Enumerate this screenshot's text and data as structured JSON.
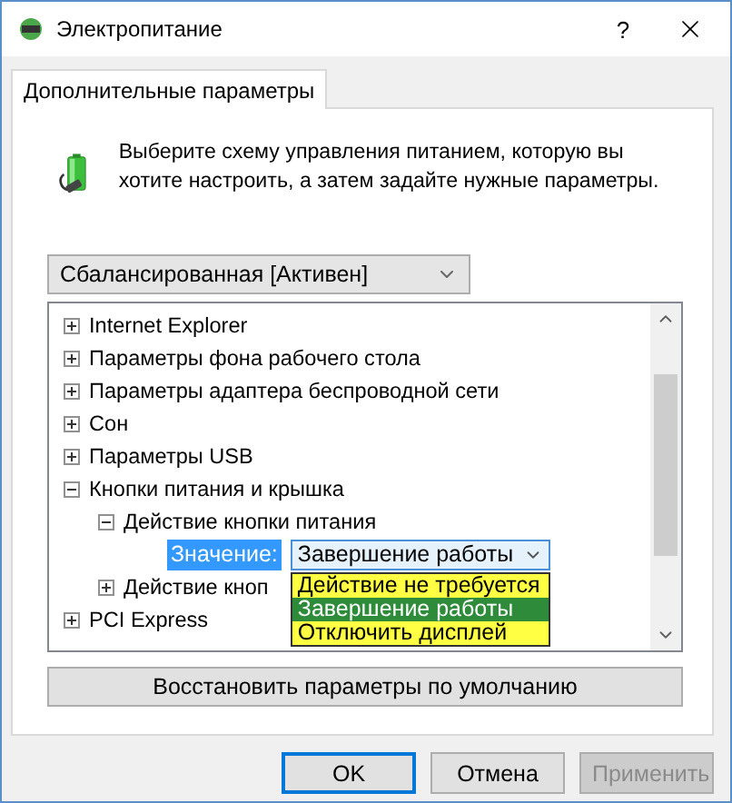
{
  "window": {
    "title": "Электропитание",
    "help": "?"
  },
  "tabs": [
    {
      "label": "Дополнительные параметры",
      "selected": true
    }
  ],
  "intro": "Выберите схему управления питанием, которую вы хотите настроить, а затем задайте нужные параметры.",
  "scheme": {
    "value": "Сбалансированная [Активен]"
  },
  "tree": [
    {
      "label": "Internet Explorer",
      "expanded": false
    },
    {
      "label": "Параметры фона рабочего стола",
      "expanded": false
    },
    {
      "label": "Параметры адаптера беспроводной сети",
      "expanded": false
    },
    {
      "label": "Сон",
      "expanded": false
    },
    {
      "label": "Параметры USB",
      "expanded": false
    },
    {
      "label": "Кнопки питания и крышка",
      "expanded": true,
      "children": [
        {
          "label": "Действие кнопки питания",
          "expanded": true,
          "children": [
            {
              "kind": "setting",
              "label": "Значение:",
              "selected": true,
              "value": "Завершение работы",
              "open": true,
              "options": [
                {
                  "label": "Действие не требуется",
                  "selected": false
                },
                {
                  "label": "Завершение работы",
                  "selected": true
                },
                {
                  "label": "Отключить дисплей",
                  "selected": false
                }
              ]
            }
          ]
        },
        {
          "label": "Действие кноп",
          "expanded": false
        }
      ]
    },
    {
      "label": "PCI Express",
      "expanded": false
    }
  ],
  "restore_button": "Восстановить параметры по умолчанию",
  "buttons": [
    {
      "label": "OK",
      "disabled": false,
      "default": true
    },
    {
      "label": "Отмена",
      "disabled": false,
      "default": false
    },
    {
      "label": "Применить",
      "disabled": true,
      "default": false
    }
  ]
}
